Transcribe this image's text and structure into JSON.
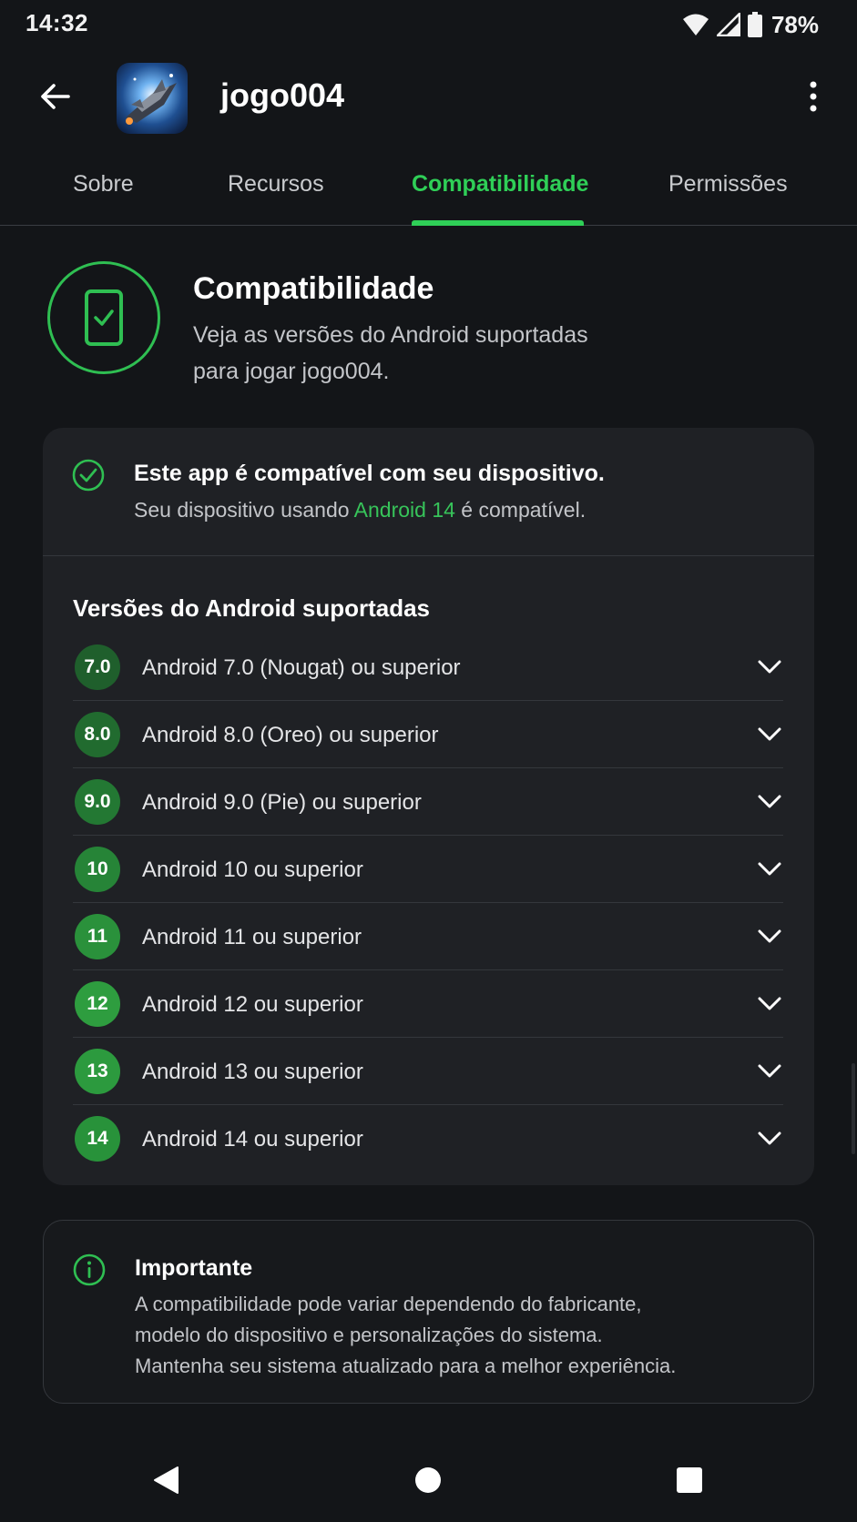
{
  "status_bar": {
    "time": "14:32",
    "battery_percent": "78%",
    "icons": [
      "wifi-icon",
      "signal-icon",
      "battery-icon"
    ]
  },
  "app_bar": {
    "title": "jogo004",
    "back_icon": "arrow-left-icon",
    "more_icon": "more-vert-icon",
    "app_icon": "spaceship-game-icon"
  },
  "tabs": [
    {
      "label": "Sobre",
      "active": false
    },
    {
      "label": "Recursos",
      "active": false
    },
    {
      "label": "Compatibilidade",
      "active": true
    },
    {
      "label": "Permissões",
      "active": false
    }
  ],
  "header": {
    "icon": "phone-check-icon",
    "title": "Compatibilidade",
    "subtitle_line1": "Veja as versões do Android suportadas",
    "subtitle_line2": "para jogar jogo004."
  },
  "compat_status": {
    "icon": "check-circle-icon",
    "title": "Este app é compatível com seu dispositivo.",
    "desc_prefix": "Seu dispositivo usando ",
    "desc_highlight": "Android 14",
    "desc_suffix": " é compatível."
  },
  "versions": {
    "heading": "Versões do Android suportadas",
    "items": [
      {
        "badge": "7.0",
        "label": "Android 7.0 (Nougat) ou superior",
        "color": "#1f5f2c"
      },
      {
        "badge": "8.0",
        "label": "Android 8.0 (Oreo) ou superior",
        "color": "#216b2f"
      },
      {
        "badge": "9.0",
        "label": "Android 9.0 (Pie) ou superior",
        "color": "#237833"
      },
      {
        "badge": "10",
        "label": "Android 10 ou superior",
        "color": "#268437"
      },
      {
        "badge": "11",
        "label": "Android 11 ou superior",
        "color": "#2a913b"
      },
      {
        "badge": "12",
        "label": "Android 12 ou superior",
        "color": "#2e9d3f"
      },
      {
        "badge": "13",
        "label": "Android 13 ou superior",
        "color": "#2c9a3e"
      },
      {
        "badge": "14",
        "label": "Android 14 ou superior",
        "color": "#28923a"
      }
    ],
    "chevron_icon": "chevron-down-icon"
  },
  "info": {
    "icon": "info-icon",
    "title": "Importante",
    "line1": "A compatibilidade pode variar dependendo do fabricante,",
    "line2": "modelo do dispositivo e personalizações do sistema.",
    "line3": "Mantenha seu sistema atualizado para a melhor experiência."
  },
  "nav_bar": {
    "back_icon": "nav-back-icon",
    "home_icon": "nav-home-icon",
    "recents_icon": "nav-recents-icon"
  },
  "colors": {
    "accent": "#2fcf57",
    "background": "#131518",
    "card": "#1f2125"
  }
}
